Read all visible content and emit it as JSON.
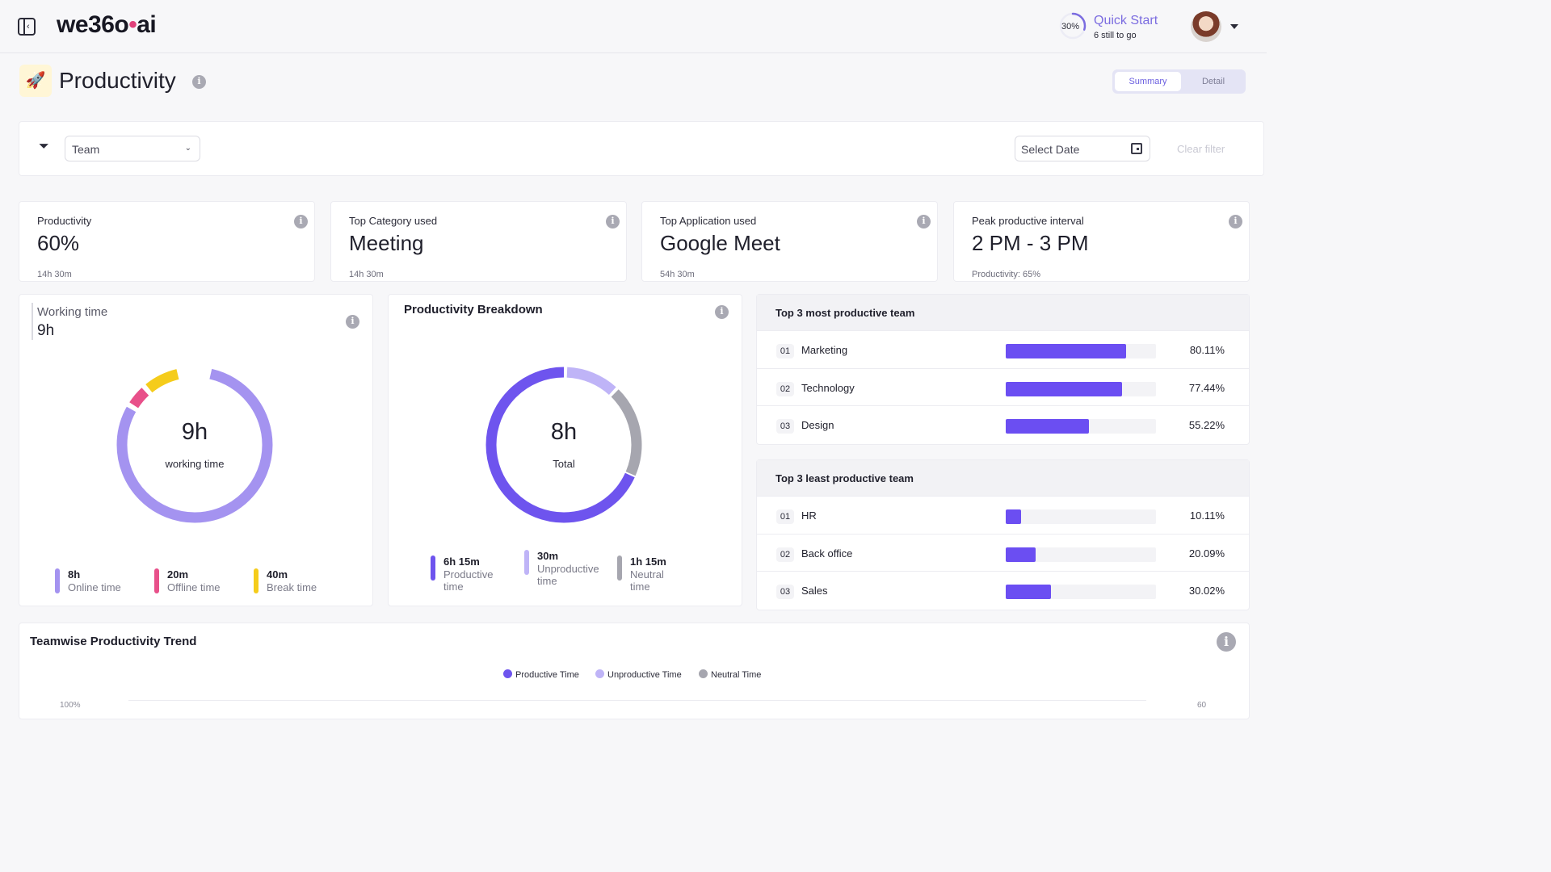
{
  "header": {
    "logo_text_a": "we36",
    "logo_text_b": "o",
    "logo_text_c": "ai",
    "quick_start": {
      "percent_label": "30%",
      "progress": 0.3,
      "title": "Quick Start",
      "subtitle": "6 still to go"
    }
  },
  "page": {
    "title": "Productivity",
    "view_tabs": {
      "summary": "Summary",
      "detail": "Detail",
      "active": "Summary"
    }
  },
  "filters": {
    "team_value": "Team",
    "date_placeholder": "Select Date",
    "clear_label": "Clear filter"
  },
  "stats": [
    {
      "label": "Productivity",
      "value": "60%",
      "sub": "14h 30m"
    },
    {
      "label": "Top Category used",
      "value": "Meeting",
      "sub": "14h 30m"
    },
    {
      "label": "Top Application used",
      "value": "Google Meet",
      "sub": "54h 30m"
    },
    {
      "label": "Peak productive interval",
      "value": "2 PM - 3 PM",
      "sub": "Productivity: 65%"
    }
  ],
  "working_time": {
    "label": "Working time",
    "value": "9h",
    "center_value": "9h",
    "center_label": "working time",
    "legend": [
      {
        "value": "8h",
        "label": "Online time",
        "color": "#a493f0"
      },
      {
        "value": "20m",
        "label": "Offline time",
        "color": "#e8508a"
      },
      {
        "value": "40m",
        "label": "Break time",
        "color": "#f5cc1b"
      }
    ]
  },
  "breakdown": {
    "title": "Productivity Breakdown",
    "center_value": "8h",
    "center_label": "Total",
    "legend": [
      {
        "value": "6h 15m",
        "label": "Productive time",
        "color": "#6e54ee"
      },
      {
        "value": "30m",
        "label": "Unproductive time",
        "color": "#bfb4f7"
      },
      {
        "value": "1h 15m",
        "label": "Neutral time",
        "color": "#a6a6af"
      }
    ]
  },
  "most_productive": {
    "title": "Top 3 most productive team",
    "rows": [
      {
        "rank": "01",
        "name": "Marketing",
        "pct": "80.11%",
        "value": 80.11
      },
      {
        "rank": "02",
        "name": "Technology",
        "pct": "77.44%",
        "value": 77.44
      },
      {
        "rank": "03",
        "name": "Design",
        "pct": "55.22%",
        "value": 55.22
      }
    ]
  },
  "least_productive": {
    "title": "Top 3 least productive team",
    "rows": [
      {
        "rank": "01",
        "name": "HR",
        "pct": "10.11%",
        "value": 10.11
      },
      {
        "rank": "02",
        "name": "Back office",
        "pct": "20.09%",
        "value": 20.09
      },
      {
        "rank": "03",
        "name": "Sales",
        "pct": "30.02%",
        "value": 30.02
      }
    ]
  },
  "trend": {
    "title": "Teamwise Productivity Trend",
    "legend": [
      {
        "label": "Productive Time",
        "color": "#6e54ee"
      },
      {
        "label": "Unproductive Time",
        "color": "#bfb4f7"
      },
      {
        "label": "Neutral Time",
        "color": "#a6a6af"
      }
    ],
    "y_left_top": "100%",
    "y_right_top": "60"
  },
  "colors": {
    "accent": "#6b4ef2",
    "brand_pink": "#e0407a"
  }
}
